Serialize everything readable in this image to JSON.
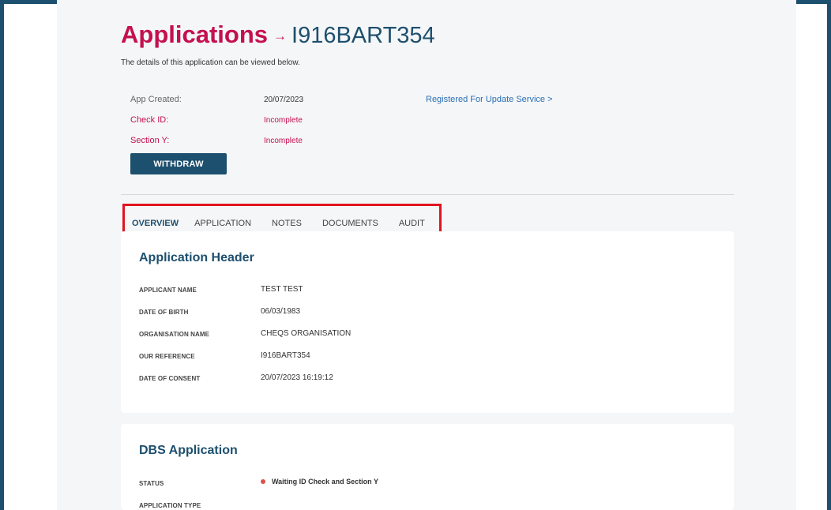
{
  "header": {
    "title": "Applications",
    "arrow": "→",
    "reference": "I916BART354",
    "subtitle": "The details of this application can be viewed below."
  },
  "summary": {
    "app_created_label": "App Created:",
    "app_created_value": "20/07/2023",
    "check_id_label": "Check ID:",
    "check_id_value": "Incomplete",
    "section_y_label": "Section Y:",
    "section_y_value": "Incomplete",
    "update_service_link": "Registered For Update Service >",
    "withdraw_label": "WITHDRAW"
  },
  "tabs": [
    {
      "label": "OVERVIEW",
      "active": true
    },
    {
      "label": "APPLICATION",
      "active": false
    },
    {
      "label": "NOTES",
      "active": false
    },
    {
      "label": "DOCUMENTS",
      "active": false
    },
    {
      "label": "AUDIT",
      "active": false
    }
  ],
  "application_header": {
    "title": "Application Header",
    "rows": [
      {
        "label": "APPLICANT NAME",
        "value": "TEST TEST"
      },
      {
        "label": "DATE OF BIRTH",
        "value": "06/03/1983"
      },
      {
        "label": "ORGANISATION NAME",
        "value": "CHEQS ORGANISATION"
      },
      {
        "label": "OUR REFERENCE",
        "value": "I916BART354"
      },
      {
        "label": "DATE OF CONSENT",
        "value": "20/07/2023 16:19:12"
      }
    ]
  },
  "dbs_application": {
    "title": "DBS Application",
    "status_label": "STATUS",
    "status_value": "Waiting ID Check and Section Y",
    "status_color": "#d9534f",
    "application_type_label": "APPLICATION TYPE"
  },
  "colors": {
    "brand_red": "#c4104f",
    "brand_navy": "#1d4f6e",
    "link_blue": "#2a6fb6",
    "highlight_red": "#e0141e"
  }
}
